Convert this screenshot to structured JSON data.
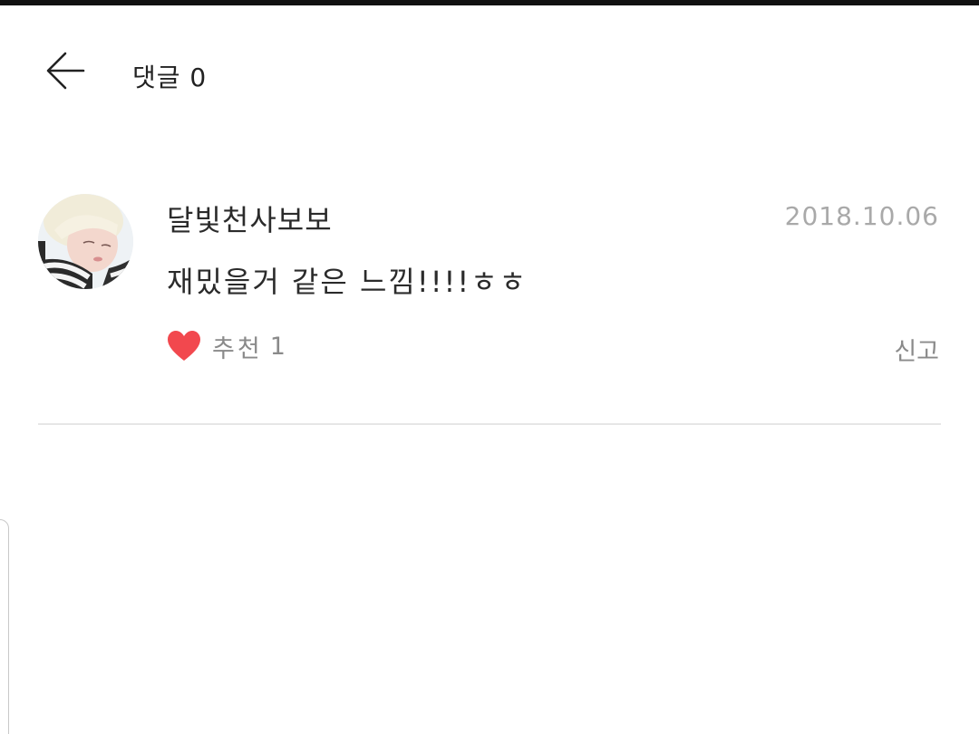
{
  "header": {
    "title": "댓글 0"
  },
  "comment": {
    "username": "달빛천사보보",
    "date": "2018.10.06",
    "text": "재밌을거 같은 느낌!!!!ㅎㅎ",
    "like_label": "추천",
    "like_count": "1",
    "report_label": "신고"
  },
  "icons": {
    "back": "arrow-left-icon",
    "like": "heart-icon",
    "avatar": "user-avatar"
  },
  "colors": {
    "heart": "#f2484e",
    "date": "#a9a9a9",
    "muted": "#8a8a8a",
    "divider": "#e6e6e6"
  }
}
